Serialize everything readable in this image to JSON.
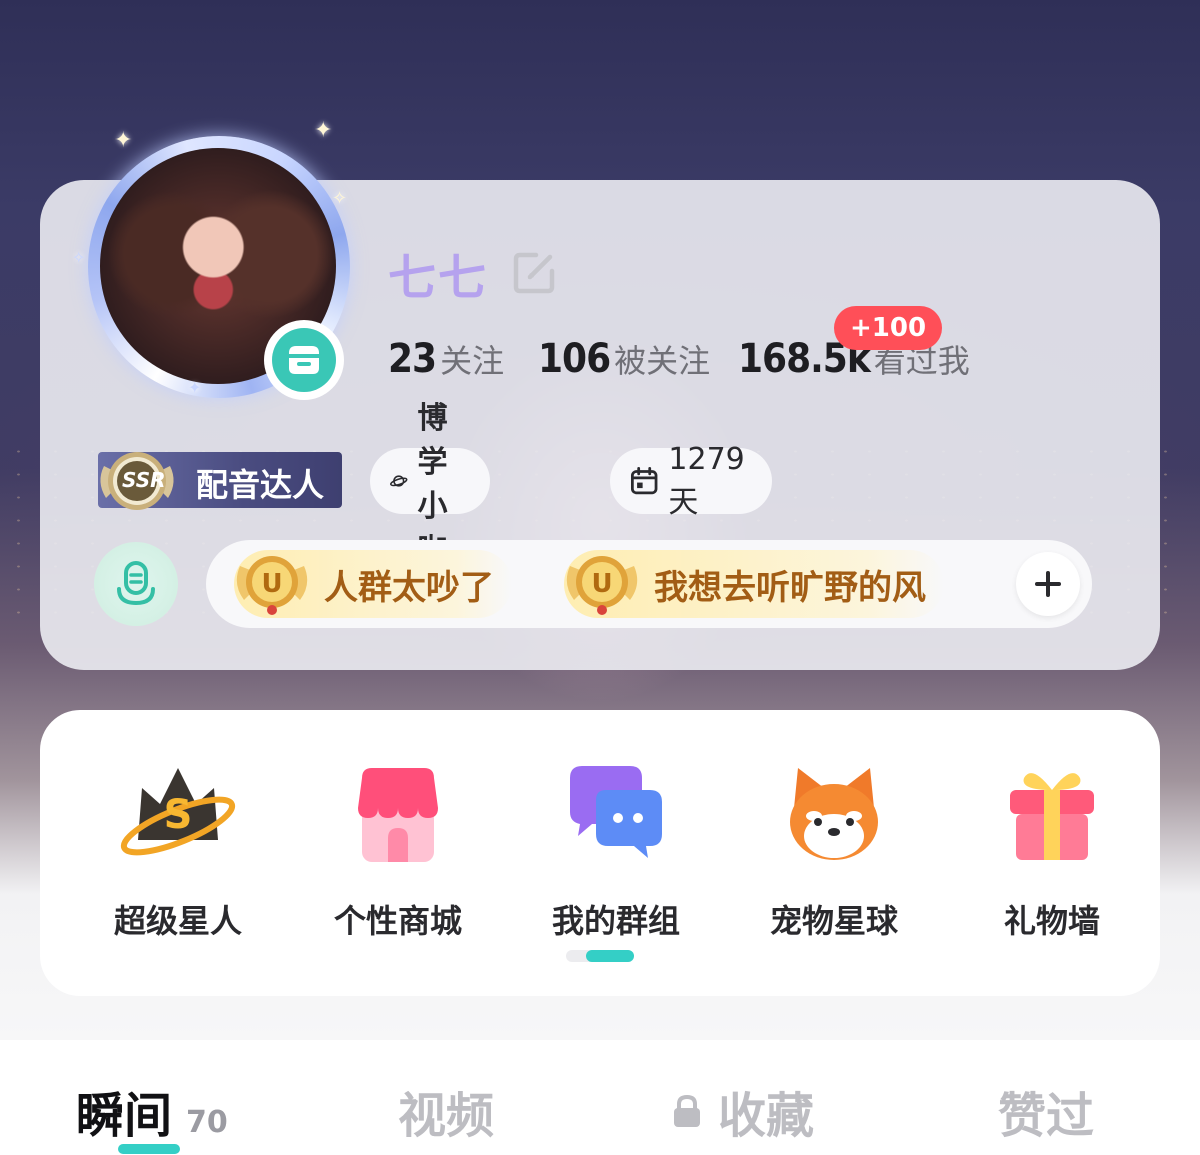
{
  "profile": {
    "username": "七七",
    "stats": [
      {
        "value": "23",
        "label": "关注"
      },
      {
        "value": "106",
        "label": "被关注"
      },
      {
        "value": "168.5k",
        "label": "看过我"
      }
    ],
    "views_badge": "+100",
    "ssr_title": "配音达人",
    "ssr_badge_text": "SSR",
    "chips": [
      {
        "icon": "planet-icon",
        "label": "博学小咖"
      },
      {
        "icon": "calendar-icon",
        "label": "1279天"
      }
    ],
    "medals": [
      {
        "icon": "medal-icon",
        "label": "人群太吵了"
      },
      {
        "icon": "medal-icon",
        "label": "我想去听旷野的风"
      }
    ]
  },
  "features": [
    {
      "icon": "crown-icon",
      "label": "超级星人"
    },
    {
      "icon": "shop-icon",
      "label": "个性商城"
    },
    {
      "icon": "chat-group-icon",
      "label": "我的群组"
    },
    {
      "icon": "pet-icon",
      "label": "宠物星球"
    },
    {
      "icon": "gift-icon",
      "label": "礼物墙"
    }
  ],
  "pager": {
    "current_page": 2,
    "total_pages": 2
  },
  "tabs": [
    {
      "label": "瞬间",
      "count": "70",
      "active": true
    },
    {
      "label": "视频"
    },
    {
      "label": "收藏",
      "locked": true
    },
    {
      "label": "赞过"
    }
  ],
  "colors": {
    "accent": "#34cfc6",
    "username": "#b5a2ee",
    "badge_red": "#ff4f58",
    "medal_text": "#a25d15"
  }
}
